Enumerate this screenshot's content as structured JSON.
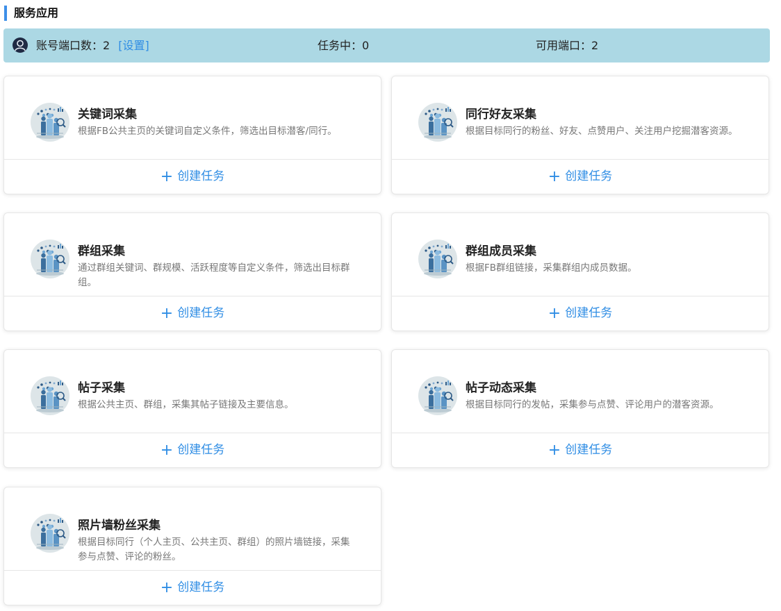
{
  "section": {
    "title": "服务应用"
  },
  "stats": {
    "accounts_label": "账号端口数：",
    "accounts_value": "2",
    "settings_link": "[设置]",
    "tasks_label": "任务中：",
    "tasks_value": "0",
    "available_label": "可用端口：",
    "available_value": "2"
  },
  "cards": [
    {
      "title": "关键词采集",
      "desc": "根据FB公共主页的关键词自定义条件，筛选出目标潜客/同行。",
      "action": "创建任务"
    },
    {
      "title": "同行好友采集",
      "desc": "根据目标同行的粉丝、好友、点赞用户、关注用户挖掘潜客资源。",
      "action": "创建任务"
    },
    {
      "title": "群组采集",
      "desc": "通过群组关键词、群规模、活跃程度等自定义条件，筛选出目标群组。",
      "action": "创建任务"
    },
    {
      "title": "群组成员采集",
      "desc": "根据FB群组链接，采集群组内成员数据。",
      "action": "创建任务"
    },
    {
      "title": "帖子采集",
      "desc": "根据公共主页、群组，采集其帖子链接及主要信息。",
      "action": "创建任务"
    },
    {
      "title": "帖子动态采集",
      "desc": "根据目标同行的发帖，采集参与点赞、评论用户的潜客资源。",
      "action": "创建任务"
    },
    {
      "title": "照片墙粉丝采集",
      "desc": "根据目标同行（个人主页、公共主页、群组）的照片墙链接，采集参与点赞、评论的粉丝。",
      "action": "创建任务"
    }
  ],
  "icons": {
    "avatar": "user-avatar-icon",
    "card": "data-analytics-icon",
    "action": "plus-icon"
  },
  "colors": {
    "accent": "#2f8de4",
    "stats_bg": "#acd8e4",
    "title_bar": "#3d8fe8"
  }
}
